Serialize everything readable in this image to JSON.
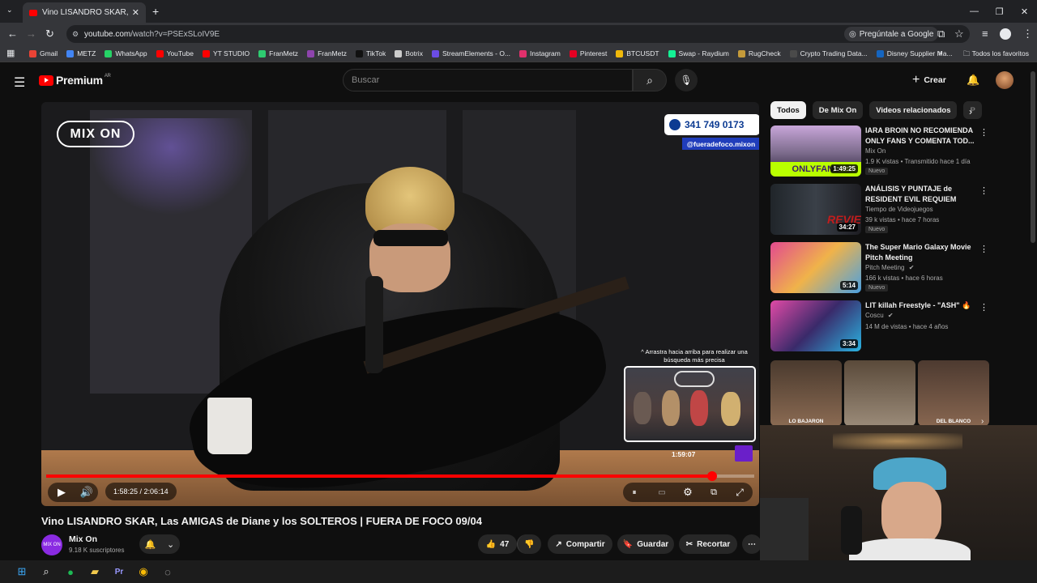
{
  "browser": {
    "tab_title": "Vino LISANDRO SKAR, Las AMIG",
    "url_host": "youtube.com",
    "url_path": "/watch?v=PSExSLoIV9E",
    "google_button": "Pregúntale a Google",
    "bookmarks": [
      "Gmail",
      "METZ",
      "WhatsApp",
      "YouTube",
      "YT STUDIO",
      "FranMetz",
      "FranMetz",
      "TikTok",
      "Botrix",
      "StreamElements - O...",
      "Instagram",
      "Pinterest",
      "BTCUSDT",
      "Swap - Raydium",
      "RugCheck",
      "Crypto Trading Data...",
      "Disney Supplier Ma..."
    ],
    "bookmark_colors": [
      "#ea4335",
      "#4285f4",
      "#25d366",
      "#ff0000",
      "#ff0000",
      "#2ecc71",
      "#8e44ad",
      "#111111",
      "#cccccc",
      "#6b4ce6",
      "#e1306c",
      "#e60023",
      "#f0b90b",
      "#14f195",
      "#c49a3a",
      "#4a4a4a",
      "#1565c0"
    ],
    "all_bookmarks": "Todos los favoritos"
  },
  "youtube": {
    "logo": "Premium",
    "region": "AR",
    "search_placeholder": "Buscar",
    "create_label": "Crear"
  },
  "video": {
    "overlay_logo": "MIX ON",
    "phone": "341 749 0173",
    "handle": "@fueradefoco.mixon",
    "seek_hint": "^ Arrastra hacia arriba para realizar una búsqueda más precisa",
    "preview_time": "1:59:07",
    "current_time": "1:58:25",
    "separator": " / ",
    "duration": "2:06:14",
    "progress_fraction": 0.94,
    "title": "Vino LISANDRO SKAR, Las AMIGAS de Diane y los SOLTEROS | FUERA DE FOCO 09/04"
  },
  "channel": {
    "name": "Mix On",
    "subscribers": "9.18 K suscriptores",
    "avatar_text": "MIX ON"
  },
  "actions": {
    "likes": "47",
    "share": "Compartir",
    "save": "Guardar",
    "clip": "Recortar"
  },
  "chips": [
    "Todos",
    "De Mix On",
    "Videos relacionados",
    "P"
  ],
  "recommendations": [
    {
      "title": "IARA BROIN NO RECOMIENDA ONLY FANS Y COMENTA TOD...",
      "channel": "Mix On",
      "meta": "1.9 K vistas • Transmitido hace 1 día",
      "badge": "Nuevo",
      "duration": "1:49:25",
      "thumb": "ONLYFANS"
    },
    {
      "title": "ANÁLISIS Y PUNTAJE de RESIDENT EVIL REQUIEM",
      "channel": "Tiempo de Videojuegos",
      "meta": "39 k vistas • hace 7 horas",
      "badge": "Nuevo",
      "duration": "34:27",
      "thumb": "REVIEW"
    },
    {
      "title": "The Super Mario Galaxy Movie Pitch Meeting",
      "channel": "Pitch Meeting",
      "meta": "166 k vistas • hace 6 horas",
      "badge": "Nuevo",
      "duration": "5:14",
      "thumb": ""
    },
    {
      "title": "LIT killah Freestyle - \"ASH\"",
      "channel": "Coscu",
      "meta": "14 M de vistas • hace 4 años",
      "badge": "",
      "duration": "3:34",
      "thumb": ""
    }
  ],
  "shorts": [
    "LO BAJARON",
    "",
    "DEL BLANCO"
  ]
}
